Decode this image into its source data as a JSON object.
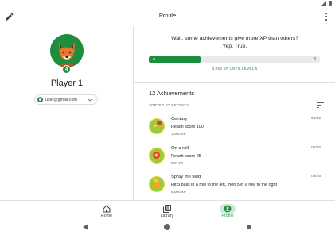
{
  "header": {
    "title": "Profile"
  },
  "profile": {
    "level": "4",
    "player_name": "Player 1",
    "email": "user@gmail.com"
  },
  "xp": {
    "message_line1": "Wait, some achievements give more XP than others?",
    "message_line2": "Yep. True.",
    "current_level": "4",
    "next_level": "5",
    "progress_fraction": 0.3,
    "until_text": "3,000 XP UNTIL LEVEL 5"
  },
  "achievements": {
    "title": "12 Achievements",
    "sorted_label": "SORTED BY RECENCY",
    "items": [
      {
        "name": "Century",
        "description": "Reach score 100",
        "xp": "1,000 XP",
        "date": "08/25"
      },
      {
        "name": "On a roll",
        "description": "Reach score 25",
        "xp": "500 XP",
        "date": "08/25"
      },
      {
        "name": "Spray the field",
        "description": "Hit 5 balls in a row to the left, then 5 in a row to the right",
        "xp": "5,000 XP",
        "date": "08/25"
      }
    ]
  },
  "nav": {
    "items": [
      {
        "label": "Home",
        "icon": "home-icon"
      },
      {
        "label": "Library",
        "icon": "library-icon"
      },
      {
        "label": "Profile",
        "icon": "profile-icon"
      }
    ]
  },
  "colors": {
    "accent": "#1e8e3e",
    "accent_light": "#ceead6",
    "divider": "#e0e0e0"
  }
}
